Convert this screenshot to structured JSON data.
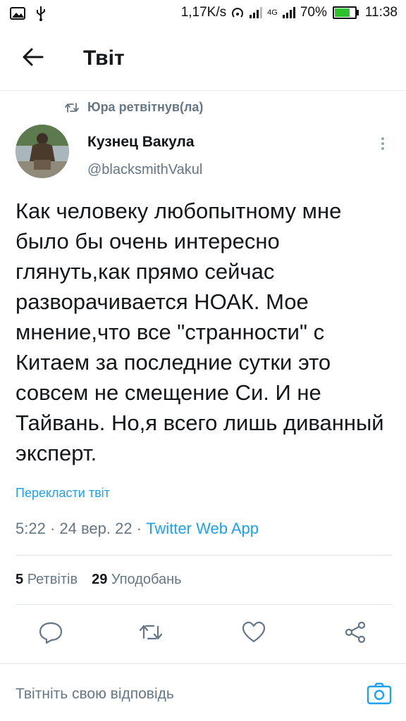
{
  "statusbar": {
    "speed": "1,17K/s",
    "network": "4G",
    "battery": "70%",
    "battery_level": 0.7,
    "time": "11:38"
  },
  "header": {
    "title": "Твіт"
  },
  "tweet": {
    "retweeted_by": "Юра ретвітнув(ла)",
    "author_name": "Кузнец Вакула",
    "author_handle": "@blacksmithVakul",
    "text": "Как человеку любопытному мне было бы очень интересно глянуть,как прямо сейчас разворачивается НОАК. Мое мнение,что все \"странности\" с Китаем за последние сутки это совсем не смещение Си. И не Тайвань. Но,я всего лишь диванный эксперт.",
    "translate_label": "Перекласти твіт",
    "time": "5:22",
    "date": "24 вер. 22",
    "app": "Twitter Web App",
    "separator": "·"
  },
  "stats": {
    "retweets_count": "5",
    "retweets_label": "Ретвітів",
    "likes_count": "29",
    "likes_label": "Уподобань"
  },
  "reply": {
    "placeholder": "Твітніть свою відповідь"
  },
  "colors": {
    "accent": "#1da1f2",
    "secondary_text": "#657786",
    "divider": "#e1e8ed"
  }
}
